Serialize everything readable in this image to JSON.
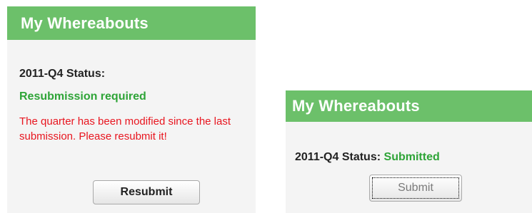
{
  "panels": [
    {
      "title": "My Whereabouts",
      "status_label": "2011-Q4 Status:",
      "status_value": "Resubmission required",
      "message": "The quarter has been modified since the last submission. Please resubmit it!",
      "button_label": "Resubmit"
    },
    {
      "title": "My Whereabouts",
      "status_label": "2011-Q4 Status:",
      "status_value": "Submitted",
      "button_label": "Submit"
    }
  ],
  "colors": {
    "header_bg": "#6cc06a",
    "status_green": "#2ea437",
    "warning_red": "#e8151f",
    "panel_bg": "#f4f4f4"
  }
}
